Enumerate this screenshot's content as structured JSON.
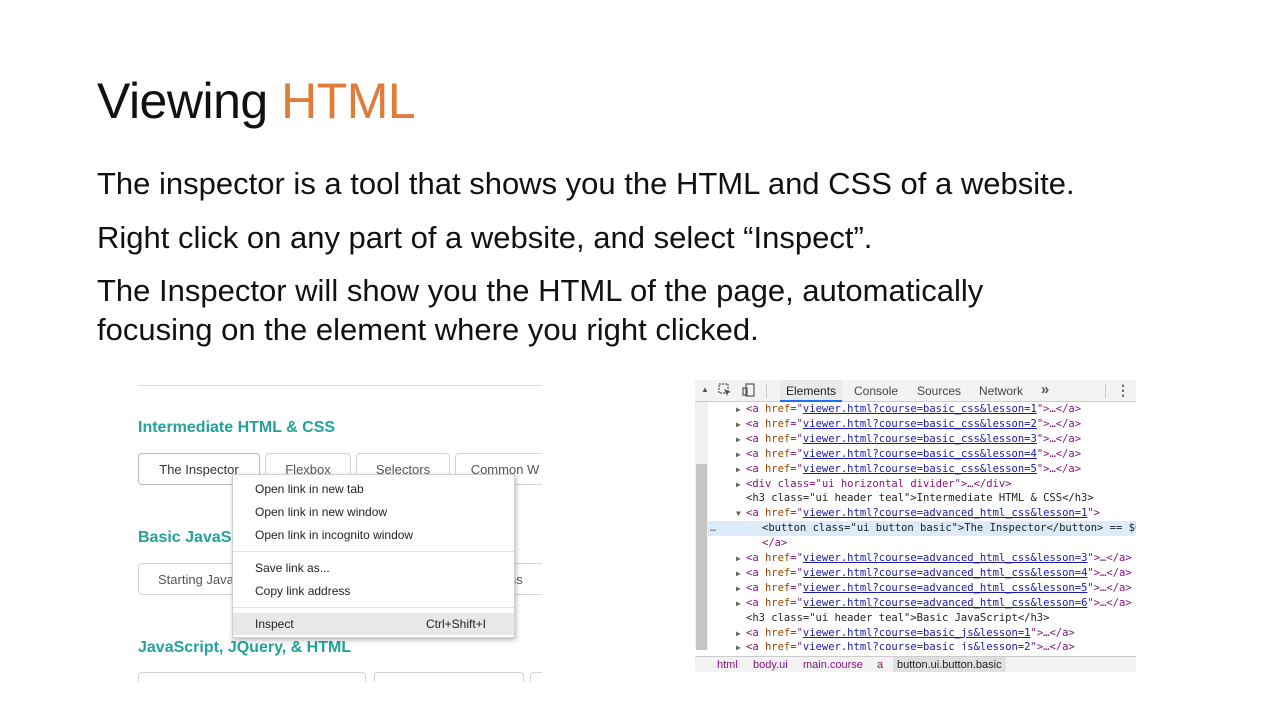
{
  "slide": {
    "title_main": "Viewing ",
    "title_accent": "HTML",
    "bullets": [
      "The inspector is a tool that shows you the HTML and CSS of a website.",
      "Right click on any part of a website, and select “Inspect”.",
      "The Inspector will show you the HTML of the page, automatically",
      "focusing on the element where you right clicked."
    ]
  },
  "accent_color": "#E07B39",
  "site": {
    "sections": [
      {
        "heading": "Intermediate HTML & CSS"
      },
      {
        "heading": "Basic JavaSc"
      },
      {
        "heading": "JavaScript, JQuery, & HTML"
      }
    ],
    "row1_buttons": [
      "The Inspector",
      "Flexbox",
      "Selectors",
      "Common W"
    ],
    "row2_buttons": [
      "Starting Java",
      "ns"
    ],
    "heading_color": "#21a39b"
  },
  "context_menu": {
    "items": [
      {
        "label": "Open link in new tab"
      },
      {
        "label": "Open link in new window"
      },
      {
        "label": "Open link in incognito window"
      },
      {
        "label": "Save link as..."
      },
      {
        "label": "Copy link address"
      },
      {
        "label": "Inspect",
        "shortcut": "Ctrl+Shift+I",
        "highlighted": true
      }
    ]
  },
  "devtools": {
    "tabs": [
      "Elements",
      "Console",
      "Sources",
      "Network"
    ],
    "active_tab": "Elements",
    "more_tabs_icon": "double-chevron-right-icon",
    "menu_icon": "vertical-ellipsis-icon",
    "lines": [
      {
        "indent": 1,
        "tri": "▶",
        "kind": "link",
        "href": "viewer.html?course=basic_css&lesson=1",
        "tail": ">…</a>"
      },
      {
        "indent": 1,
        "tri": "▶",
        "kind": "link",
        "href": "viewer.html?course=basic_css&lesson=2",
        "tail": ">…</a>"
      },
      {
        "indent": 1,
        "tri": "▶",
        "kind": "link",
        "href": "viewer.html?course=basic_css&lesson=3",
        "tail": ">…</a>"
      },
      {
        "indent": 1,
        "tri": "▶",
        "kind": "link",
        "href": "viewer.html?course=basic_css&lesson=4",
        "tail": ">…</a>"
      },
      {
        "indent": 1,
        "tri": "▶",
        "kind": "link",
        "href": "viewer.html?course=basic_css&lesson=5",
        "tail": ">…</a>"
      },
      {
        "indent": 1,
        "tri": "▶",
        "kind": "div",
        "text": "<div class=\"ui horizontal divider\">…</div>"
      },
      {
        "indent": 1,
        "tri": "",
        "kind": "h3",
        "text": "<h3 class=\"ui header teal\">Intermediate HTML & CSS</h3>"
      },
      {
        "indent": 1,
        "tri": "▼",
        "kind": "link",
        "href": "viewer.html?course=advanced_html_css&lesson=1",
        "tail": ">"
      },
      {
        "indent": 2,
        "tri": "",
        "kind": "button",
        "text": "<button class=\"ui button basic\">The Inspector</button> == $0",
        "selected": true
      },
      {
        "indent": 2,
        "tri": "",
        "kind": "close",
        "text": "</a>"
      },
      {
        "indent": 1,
        "tri": "▶",
        "kind": "link",
        "href": "viewer.html?course=advanced_html_css&lesson=3",
        "tail": ">…</a>"
      },
      {
        "indent": 1,
        "tri": "▶",
        "kind": "link",
        "href": "viewer.html?course=advanced_html_css&lesson=4",
        "tail": ">…</a>"
      },
      {
        "indent": 1,
        "tri": "▶",
        "kind": "link",
        "href": "viewer.html?course=advanced_html_css&lesson=5",
        "tail": ">…</a>"
      },
      {
        "indent": 1,
        "tri": "▶",
        "kind": "link",
        "href": "viewer.html?course=advanced_html_css&lesson=6",
        "tail": ">…</a>"
      },
      {
        "indent": 1,
        "tri": "",
        "kind": "h3",
        "text": "<h3 class=\"ui header teal\">Basic JavaScript</h3>"
      },
      {
        "indent": 1,
        "tri": "▶",
        "kind": "link",
        "href": "viewer.html?course=basic_js&lesson=1",
        "tail": ">…</a>"
      },
      {
        "indent": 1,
        "tri": "▶",
        "kind": "link",
        "href": "viewer.html?course=basic_js&lesson=2",
        "tail": ">…</a>"
      }
    ],
    "breadcrumbs": [
      "html",
      "body.ui",
      "main.course",
      "a",
      "button.ui.button.basic"
    ]
  }
}
